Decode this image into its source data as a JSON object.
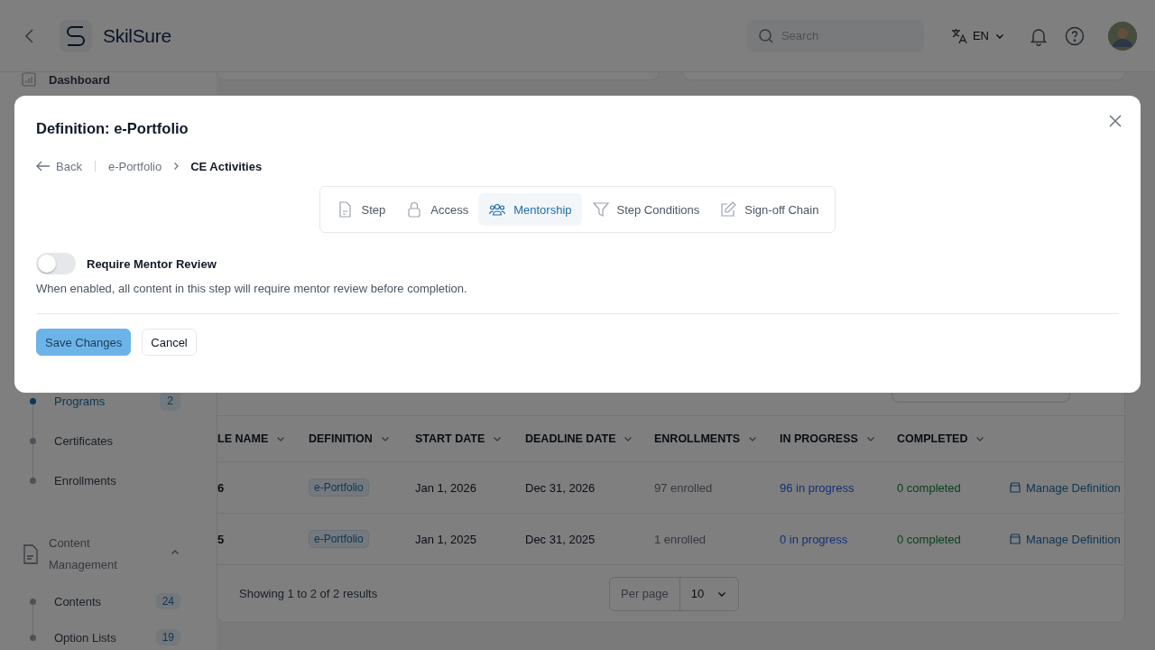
{
  "header": {
    "app_name": "SkilSure",
    "search": {
      "placeholder": "Search"
    },
    "language": "EN"
  },
  "sidebar": {
    "top_items": [
      {
        "label": "Dashboard",
        "selected": false
      }
    ],
    "sub_items": [
      {
        "label": "Programs",
        "badge": "2",
        "selected": true
      },
      {
        "label": "Certificates",
        "selected": false
      },
      {
        "label": "Enrollments",
        "selected": false
      }
    ],
    "groups": [
      {
        "label": "Content Management",
        "expanded": true,
        "children": [
          {
            "label": "Contents",
            "badge": "24",
            "selected": false
          },
          {
            "label": "Option Lists",
            "badge": "19",
            "selected": false
          }
        ]
      }
    ]
  },
  "table": {
    "columns": [
      "LE NAME",
      "DEFINITION",
      "START DATE",
      "DEADLINE DATE",
      "ENROLLMENTS",
      "IN PROGRESS",
      "COMPLETED"
    ],
    "rows": [
      {
        "name": "6",
        "definition": "e-Portfolio",
        "start_date": "Jan 1, 2026",
        "deadline_date": "Dec 31, 2026",
        "enrollments": "97 enrolled",
        "in_progress": "96 in progress",
        "completed": "0 completed",
        "action": "Manage Definition"
      },
      {
        "name": "5",
        "definition": "e-Portfolio",
        "start_date": "Jan 1, 2025",
        "deadline_date": "Dec 31, 2025",
        "enrollments": "1 enrolled",
        "in_progress": "0 in progress",
        "completed": "0 completed",
        "action": "Manage Definition"
      }
    ]
  },
  "pagination": {
    "summary": "Showing 1 to 2 of 2 results",
    "per_page_label": "Per page",
    "per_page": "10"
  },
  "modal": {
    "title": "Definition: e-Portfolio",
    "breadcrumb": {
      "back": "Back",
      "items": [
        {
          "label": "e-Portfolio",
          "current": false
        },
        {
          "label": "CE Activities",
          "current": true
        }
      ]
    },
    "tabs": [
      {
        "label": "Step",
        "kind": "document",
        "selected": false
      },
      {
        "label": "Access",
        "kind": "lock",
        "selected": false
      },
      {
        "label": "Mentorship",
        "kind": "people",
        "selected": true
      },
      {
        "label": "Step Conditions",
        "kind": "filter",
        "selected": false
      },
      {
        "label": "Sign-off Chain",
        "kind": "edit",
        "selected": false
      }
    ],
    "setting": {
      "label": "Require Mentor Review",
      "on": false,
      "description": "When enabled, all content in this step will require mentor review before completion."
    },
    "buttons": [
      {
        "label": "Save Changes",
        "kind": "primary"
      },
      {
        "label": "Cancel",
        "kind": "secondary"
      }
    ]
  }
}
